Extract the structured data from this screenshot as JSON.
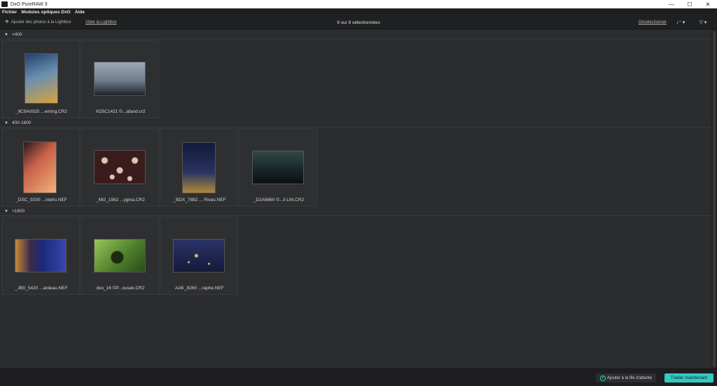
{
  "window": {
    "title": "DxO PureRAW 3",
    "controls": {
      "minimize": "—",
      "maximize": "☐",
      "close": "✕"
    }
  },
  "menu": [
    "Fichier",
    "Modules optiques DxO",
    "Aide"
  ],
  "toolbar": {
    "add_label": "Ajouter des photos à la Lightbox",
    "add_icon": "plus-icon",
    "clear_label": "Vider la Lightbox",
    "selection": "9 sur 9 sélectionnées",
    "deselect_label": "Désélectionner",
    "sort_glyph": "↓⁼ ▾",
    "filter_glyph": "▽ ▾"
  },
  "groups": [
    {
      "label": "<400",
      "items": [
        {
          "name": "_9C9A0025 ...eming.CR2",
          "thumb_colors": [
            "#22406a",
            "#6a8fb0",
            "#d6a23d"
          ]
        },
        {
          "name": "XD5C1421 ©...afand.cr2",
          "thumb_colors": [
            "#9aa8b8",
            "#4a5664",
            "#1e2328"
          ]
        }
      ]
    },
    {
      "label": "400-1600",
      "items": [
        {
          "name": "_DSC_9200 ...nteiro.NEF",
          "thumb_colors": [
            "#f2b27a",
            "#c8604a",
            "#2a1a1a"
          ]
        },
        {
          "name": "_MG_1562 ...ygina.CR2",
          "thumb_colors": [
            "#3a1c1c",
            "#d9c6b0",
            "#5a2a22"
          ]
        },
        {
          "name": "_BDX_7882 ... Rivas.NEF",
          "thumb_colors": [
            "#101a3a",
            "#2a3460",
            "#b08a3a"
          ]
        },
        {
          "name": "_D2A6860 ©...il LIN.CR2",
          "thumb_colors": [
            "#1a2a2e",
            "#2f4a44",
            "#0c1012"
          ]
        }
      ]
    },
    {
      "label": ">1600",
      "items": [
        {
          "name": "_JB0_5420 ...ardeau.NEF",
          "thumb_colors": [
            "#1b2a7a",
            "#3a46b0",
            "#c88a3a"
          ]
        },
        {
          "name": "dxo_16 ©P...ousek.CR2",
          "thumb_colors": [
            "#4a7a2a",
            "#9ac45a",
            "#1c2a12"
          ]
        },
        {
          "name": "AAK_8260 ...raphe.NEF",
          "thumb_colors": [
            "#141a3a",
            "#2a3466",
            "#e0b46a"
          ]
        }
      ]
    }
  ],
  "footer": {
    "queue_label": "Ajouter à la file d'attente",
    "process_label": "Traiter maintenant",
    "accent": "#34c9c1"
  }
}
